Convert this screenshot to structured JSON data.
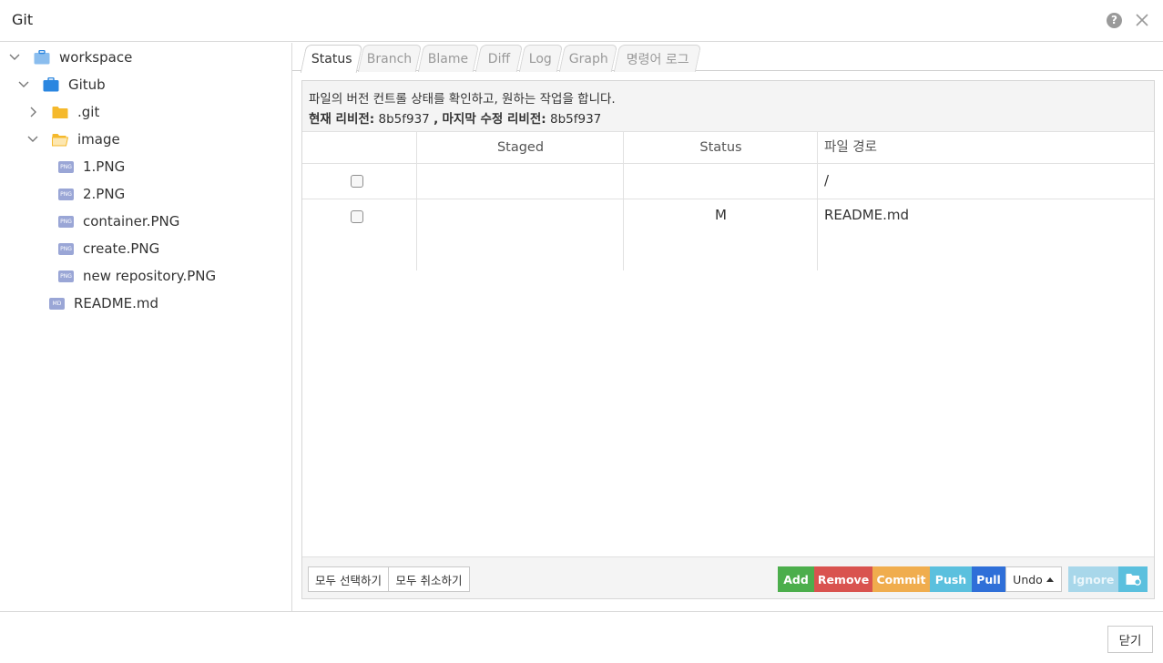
{
  "window": {
    "title": "Git"
  },
  "tree": {
    "items": [
      {
        "label": "workspace",
        "icon": "briefcase-icon",
        "expanded": true
      },
      {
        "label": "Gitub",
        "icon": "briefcase-icon",
        "expanded": true
      },
      {
        "label": ".git",
        "icon": "folder-icon",
        "expanded": false
      },
      {
        "label": "image",
        "icon": "folder-open-icon",
        "expanded": true
      },
      {
        "label": "1.PNG",
        "icon": "png-file-icon",
        "badge": "PNG"
      },
      {
        "label": "2.PNG",
        "icon": "png-file-icon",
        "badge": "PNG"
      },
      {
        "label": "container.PNG",
        "icon": "png-file-icon",
        "badge": "PNG"
      },
      {
        "label": "create.PNG",
        "icon": "png-file-icon",
        "badge": "PNG"
      },
      {
        "label": "new repository.PNG",
        "icon": "png-file-icon",
        "badge": "PNG"
      },
      {
        "label": "README.md",
        "icon": "md-file-icon",
        "badge": "MD"
      }
    ]
  },
  "tabs": [
    {
      "label": "Status",
      "active": true
    },
    {
      "label": "Branch"
    },
    {
      "label": "Blame"
    },
    {
      "label": "Diff"
    },
    {
      "label": "Log"
    },
    {
      "label": "Graph"
    },
    {
      "label": "명령어 로그"
    }
  ],
  "info": {
    "description": "파일의 버전 컨트롤 상태를 확인하고, 원하는 작업을 합니다.",
    "current_label": "현재 리비전:",
    "current_value": "8b5f937",
    "separator": ",",
    "last_label": "마지막 수정 리비전:",
    "last_value": "8b5f937"
  },
  "grid": {
    "columns": [
      "",
      "Staged",
      "Status",
      "파일 경로"
    ],
    "rows": [
      {
        "checked": false,
        "staged": "",
        "status": "",
        "path": "/"
      },
      {
        "checked": false,
        "staged": "",
        "status": "M",
        "path": "README.md"
      }
    ]
  },
  "footer": {
    "select_all": "모두 선택하기",
    "deselect_all": "모두 취소하기",
    "add": "Add",
    "remove": "Remove",
    "commit": "Commit",
    "push": "Push",
    "pull": "Pull",
    "undo": "Undo",
    "ignore": "Ignore"
  },
  "dialog": {
    "close": "닫기"
  },
  "colors": {
    "add": "#4cae4c",
    "remove": "#d9534f",
    "commit": "#f0ad4e",
    "push": "#5bc0de",
    "pull": "#2f6fd8",
    "ignore": "#a8d7ea",
    "folder": "#f5b92c",
    "briefcase": "#2a86e0",
    "file_badge": "#9aa6d6"
  }
}
